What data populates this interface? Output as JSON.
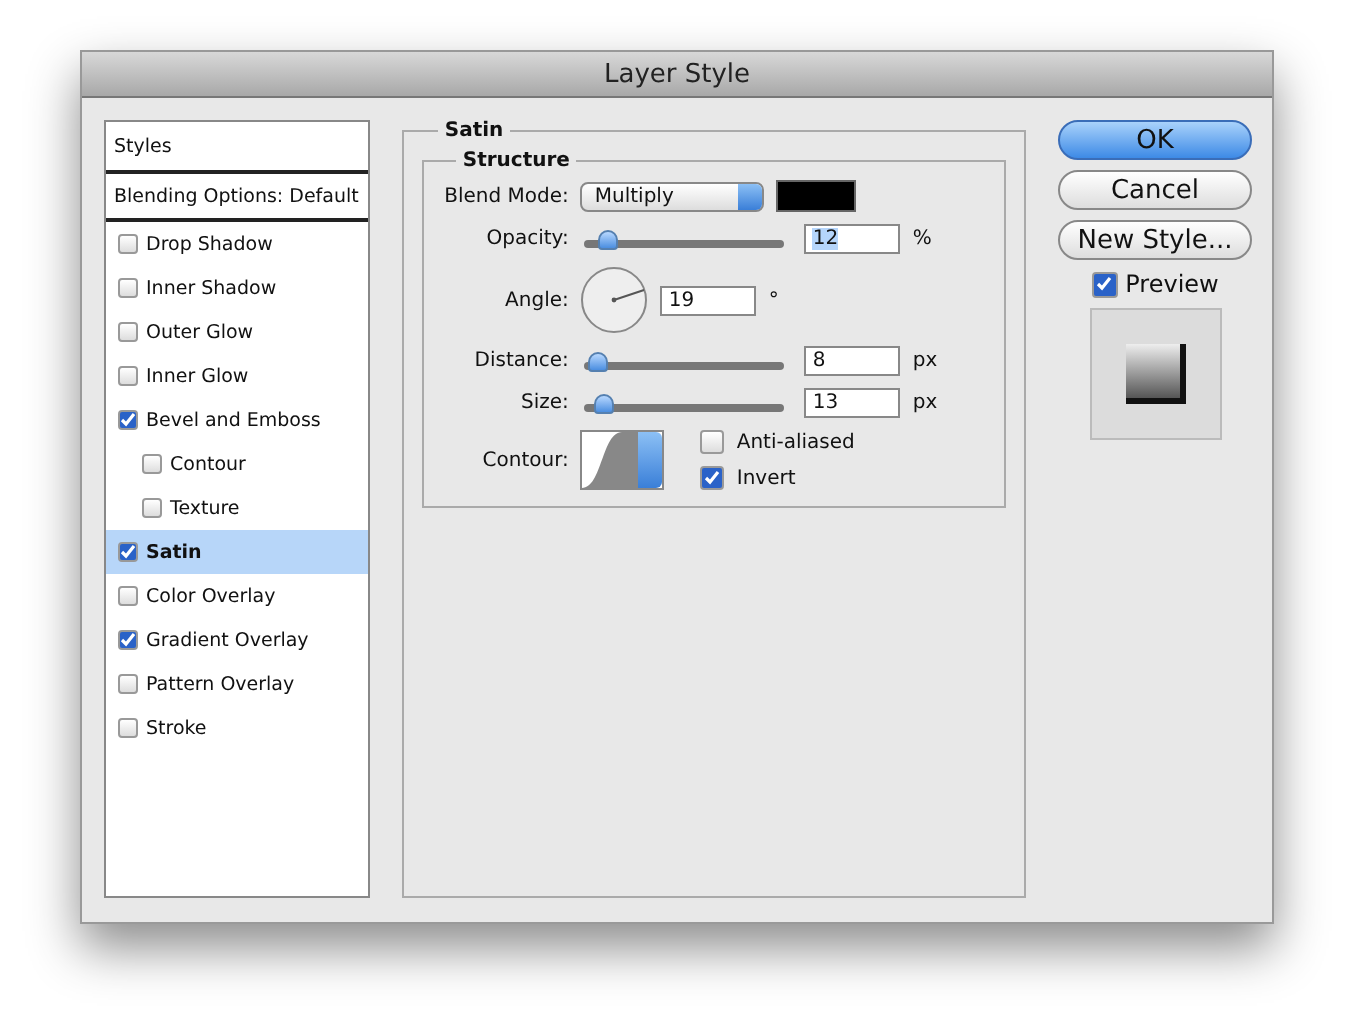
{
  "window": {
    "title": "Layer Style"
  },
  "sidebar": {
    "items": [
      {
        "kind": "header",
        "label": "Styles",
        "selected": false
      },
      {
        "kind": "options",
        "label": "Blending Options: Default",
        "selected": false
      },
      {
        "kind": "effect",
        "label": "Drop Shadow",
        "checked": false,
        "selected": false
      },
      {
        "kind": "effect",
        "label": "Inner Shadow",
        "checked": false,
        "selected": false
      },
      {
        "kind": "effect",
        "label": "Outer Glow",
        "checked": false,
        "selected": false
      },
      {
        "kind": "effect",
        "label": "Inner Glow",
        "checked": false,
        "selected": false
      },
      {
        "kind": "effect",
        "label": "Bevel and Emboss",
        "checked": true,
        "selected": false,
        "children": [
          {
            "kind": "effect",
            "label": "Contour",
            "checked": false,
            "selected": false
          },
          {
            "kind": "effect",
            "label": "Texture",
            "checked": false,
            "selected": false
          }
        ]
      },
      {
        "kind": "effect",
        "label": "Satin",
        "checked": true,
        "selected": true
      },
      {
        "kind": "effect",
        "label": "Color Overlay",
        "checked": false,
        "selected": false
      },
      {
        "kind": "effect",
        "label": "Gradient Overlay",
        "checked": true,
        "selected": false
      },
      {
        "kind": "effect",
        "label": "Pattern Overlay",
        "checked": false,
        "selected": false
      },
      {
        "kind": "effect",
        "label": "Stroke",
        "checked": false,
        "selected": false
      }
    ]
  },
  "panel": {
    "title": "Satin",
    "group": "Structure",
    "blend_mode": {
      "label": "Blend Mode:",
      "value": "Multiply"
    },
    "opacity": {
      "label": "Opacity:",
      "value": "12",
      "unit": "%",
      "level": 0.12
    },
    "angle": {
      "label": "Angle:",
      "value": "19",
      "unit": "°"
    },
    "distance": {
      "label": "Distance:",
      "value": "8",
      "unit": "px",
      "level": 0.07
    },
    "size": {
      "label": "Size:",
      "value": "13",
      "unit": "px",
      "level": 0.1
    },
    "contour": {
      "label": "Contour:"
    },
    "anti_aliased": {
      "label": "Anti-aliased",
      "checked": false
    },
    "invert": {
      "label": "Invert",
      "checked": true
    }
  },
  "buttons": [
    {
      "label": "OK",
      "primary": true
    },
    {
      "label": "Cancel",
      "primary": false
    },
    {
      "label": "New Style...",
      "primary": false
    }
  ],
  "preview": {
    "label": "Preview",
    "checked": true
  }
}
